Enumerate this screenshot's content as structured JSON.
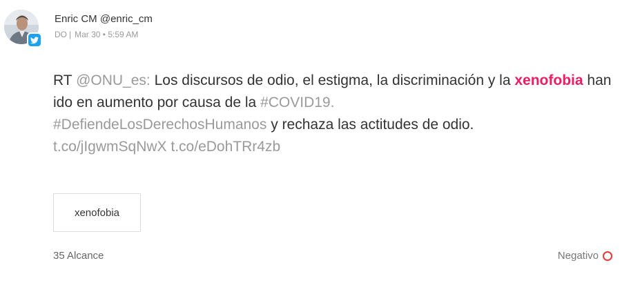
{
  "post": {
    "author": "Enric CM @enric_cm",
    "source": "DO",
    "separator": "|",
    "date": "Mar 30 • 5:59 AM",
    "network_icon": "twitter-icon",
    "avatar_icon": "user-photo",
    "text": {
      "prefix": "RT",
      "mention": "@ONU_es:",
      "part1": "Los discursos de odio, el estigma, la discriminación y la",
      "keyword": "xenofobia",
      "part2": "han ido en aumento por causa de la",
      "hashtag1": "#COVID19.",
      "hashtag2": "#DefiendeLosDerechosHumanos",
      "part3": "y rechaza las actitudes de odio.",
      "link1": "t.co/jIgwmSqNwX",
      "link2": "t.co/eDohTRr4zb"
    },
    "tag": "xenofobia",
    "reach": "35 Alcance",
    "sentiment": "Negativo",
    "colors": {
      "keyword": "#e91e63",
      "muted": "#9a9a9a",
      "negative": "#e53935",
      "twitter": "#1da1f2"
    }
  }
}
